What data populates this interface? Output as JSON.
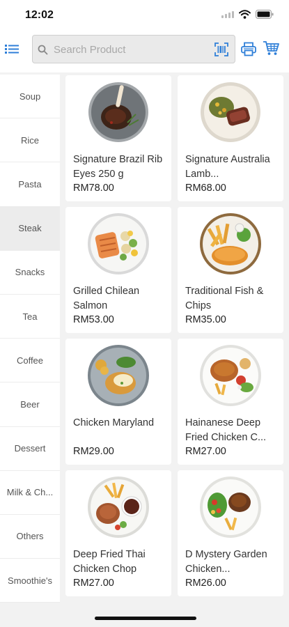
{
  "status_bar": {
    "time": "12:02"
  },
  "search": {
    "placeholder": "Search Product"
  },
  "categories": [
    {
      "label": "Soup"
    },
    {
      "label": "Rice"
    },
    {
      "label": "Pasta"
    },
    {
      "label": "Steak",
      "active": true
    },
    {
      "label": "Snacks"
    },
    {
      "label": "Tea"
    },
    {
      "label": "Coffee"
    },
    {
      "label": "Beer"
    },
    {
      "label": "Dessert"
    },
    {
      "label": "Milk & Ch..."
    },
    {
      "label": "Others"
    },
    {
      "label": "Smoothie's"
    }
  ],
  "products": [
    {
      "name": "Signature Brazil Rib Eyes 250 g",
      "price": "RM78.00",
      "image": "tomahawk-steak"
    },
    {
      "name": "Signature Australia Lamb...",
      "price": "RM68.00",
      "image": "lamb-steak"
    },
    {
      "name": "Grilled Chilean Salmon",
      "price": "RM53.00",
      "image": "salmon"
    },
    {
      "name": "Traditional Fish & Chips",
      "price": "RM35.00",
      "image": "fish-chips"
    },
    {
      "name": "Chicken Maryland",
      "price": "RM29.00",
      "image": "chicken-maryland"
    },
    {
      "name": "Hainanese Deep Fried Chicken C...",
      "price": "RM27.00",
      "image": "hainanese-chicken"
    },
    {
      "name": "Deep Fried Thai Chicken Chop",
      "price": "RM27.00",
      "image": "thai-chicken-chop"
    },
    {
      "name": "D Mystery Garden Chicken...",
      "price": "RM26.00",
      "image": "garden-chicken"
    }
  ],
  "colors": {
    "accent": "#2f7fd8",
    "background": "#f2f2f2",
    "card": "#ffffff"
  }
}
